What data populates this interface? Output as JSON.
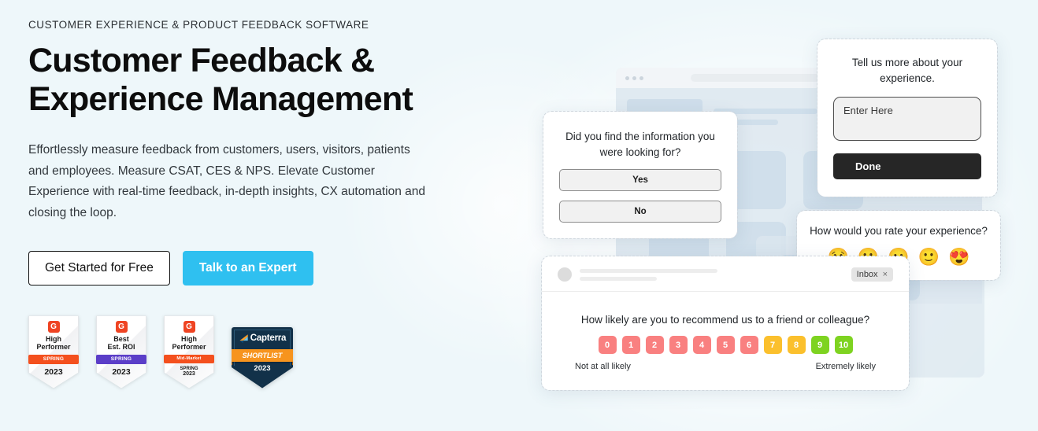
{
  "theme": {
    "page_bg": "#eef7fa",
    "accent": "#2fc0f0",
    "dark": "#262626",
    "nps_red": "#f98080",
    "nps_amber": "#fbc02d",
    "nps_green": "#7ed321"
  },
  "hero": {
    "eyebrow": "CUSTOMER EXPERIENCE & PRODUCT FEEDBACK SOFTWARE",
    "headline_line1": "Customer Feedback &",
    "headline_line2": "Experience Management",
    "subcopy": "Effortlessly measure feedback from customers, users, visitors, patients and employees. Measure CSAT, CES & NPS. Elevate Customer Experience with real-time feedback, in-depth insights, CX automation and closing the loop.",
    "primary_cta": "Talk to an Expert",
    "secondary_cta": "Get Started for Free"
  },
  "badges": [
    {
      "mark": "G",
      "title_line1": "High",
      "title_line2": "Performer",
      "ribbon": "SPRING",
      "ribbon_color": "orange",
      "year": "2023"
    },
    {
      "mark": "G",
      "title_line1": "Best",
      "title_line2": "Est. ROI",
      "ribbon": "SPRING",
      "ribbon_color": "purple",
      "year": "2023"
    },
    {
      "mark": "G",
      "title_line1": "High",
      "title_line2": "Performer",
      "ribbon": "Mid-Market",
      "ribbon_color": "orange",
      "sub": "SPRING",
      "year": "2023"
    },
    {
      "name": "Capterra",
      "ribbon": "SHORTLIST",
      "year": "2023"
    }
  ],
  "panels": {
    "yes_no": {
      "question": "Did you find the information you were looking for?",
      "options": [
        "Yes",
        "No"
      ]
    },
    "open_text": {
      "question": "Tell us more about your experience.",
      "input_placeholder": "Enter Here",
      "submit_label": "Done"
    },
    "emoji_rating": {
      "question": "How would you rate your experience?",
      "options": [
        {
          "name": "crying-face-emoji",
          "glyph": "😢"
        },
        {
          "name": "frowning-face-emoji",
          "glyph": "🙁"
        },
        {
          "name": "neutral-face-emoji",
          "glyph": "😐"
        },
        {
          "name": "slightly-smiling-face-emoji",
          "glyph": "🙂"
        },
        {
          "name": "heart-eyes-face-emoji",
          "glyph": "😍"
        }
      ]
    },
    "nps": {
      "inbox_tag": "Inbox",
      "inbox_close": "×",
      "question": "How likely are you to recommend us to a friend or colleague?",
      "low_label": "Not at all likely",
      "high_label": "Extremely likely",
      "scores": [
        "0",
        "1",
        "2",
        "3",
        "4",
        "5",
        "6",
        "7",
        "8",
        "9",
        "10"
      ]
    }
  }
}
